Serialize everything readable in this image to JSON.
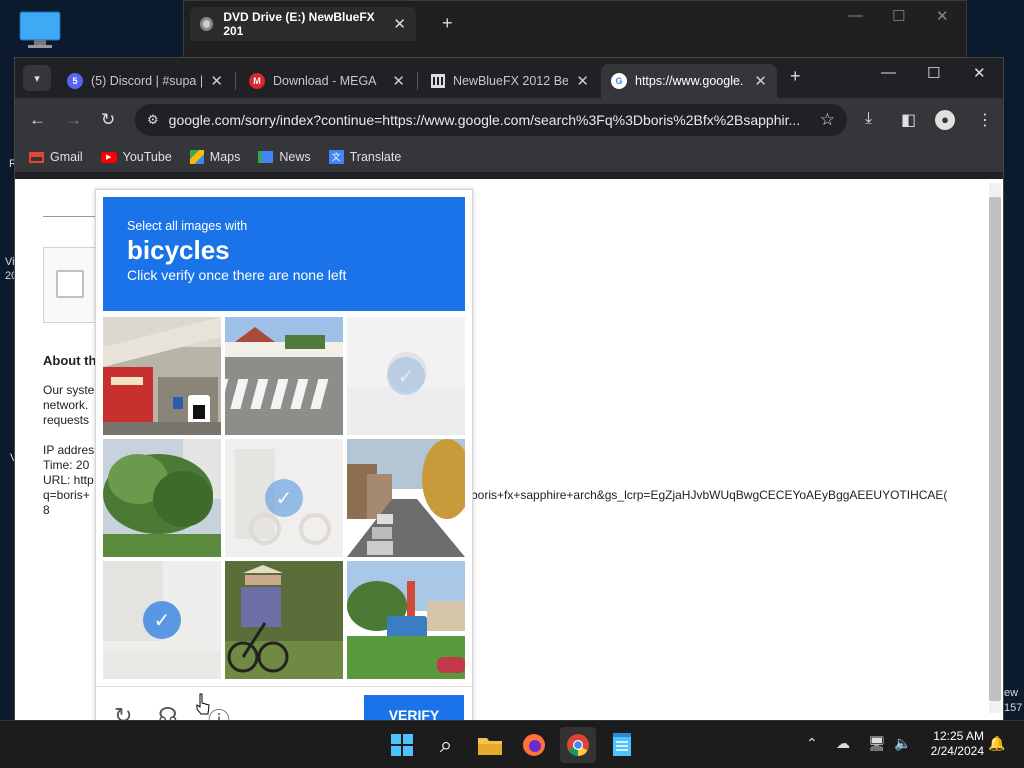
{
  "desktop": {
    "fragments": [
      "R",
      "Vi",
      "20",
      "V",
      "ew",
      "157"
    ]
  },
  "explorer": {
    "tab_title": "DVD Drive (E:) NewBlueFX 201",
    "new_tab": "+"
  },
  "chrome": {
    "tabs": [
      {
        "label": "(5) Discord | #supa | ",
        "favicon": "discord",
        "favicon_text": "5"
      },
      {
        "label": "Download - MEGA",
        "favicon": "mega",
        "favicon_text": "M"
      },
      {
        "label": "NewBlueFX 2012 Be",
        "favicon": "archive"
      },
      {
        "label": "https://www.google.",
        "favicon": "google"
      }
    ],
    "url": "google.com/sorry/index?continue=https://www.google.com/search%3Fq%3Dboris%2Bfx%2Bsapphir...",
    "bookmarks": [
      {
        "label": "Gmail",
        "icon": "gmail-icon"
      },
      {
        "label": "YouTube",
        "icon": "youtube-icon"
      },
      {
        "label": "Maps",
        "icon": "maps-icon"
      },
      {
        "label": "News",
        "icon": "news-icon"
      },
      {
        "label": "Translate",
        "icon": "translate-icon"
      }
    ]
  },
  "page": {
    "about": "About th",
    "line1": "Our syste",
    "line2": "network.",
    "line3": "requests",
    "ip": "IP addres",
    "time": "Time: 20",
    "url_label": "URL: http",
    "q_line": "q=boris+",
    "last": "8",
    "url_tail": "boris+fx+sapphire+arch&gs_lcrp=EgZjaHJvbWUqBwgCECEYoAEyBggAEEUYOTIHCAE("
  },
  "captcha": {
    "instruction": "Select all images with",
    "target": "bicycles",
    "hint": "Click verify once there are none left",
    "verify_label": "VERIFY",
    "tiles": [
      {
        "scene": "storefront",
        "selected": false
      },
      {
        "scene": "crosswalk",
        "selected": false
      },
      {
        "scene": "fading",
        "selected": true
      },
      {
        "scene": "tree",
        "selected": false
      },
      {
        "scene": "fading-bike",
        "selected": true
      },
      {
        "scene": "street-cars",
        "selected": false
      },
      {
        "scene": "fading-street",
        "selected": true
      },
      {
        "scene": "cyclist",
        "selected": false
      },
      {
        "scene": "bus-street",
        "selected": false
      }
    ]
  },
  "taskbar": {
    "time": "12:25 AM",
    "date": "2/24/2024"
  },
  "colors": {
    "accent": "#1a73e8",
    "chrome_dark": "#35363a"
  }
}
